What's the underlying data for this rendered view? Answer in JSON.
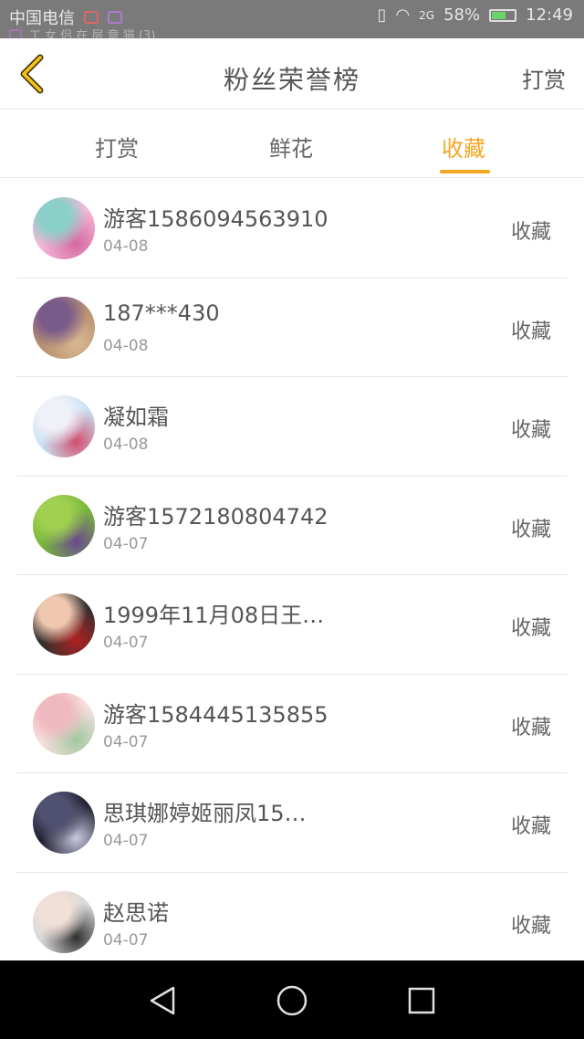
{
  "status_bar": {
    "carrier": "中国电信",
    "signal": "2G",
    "battery": "58%",
    "time": "12:49",
    "notification": "工 女 侣 在 层 章 猫 (3)"
  },
  "header": {
    "title": "粉丝荣誉榜",
    "action": "打赏",
    "back_icon": "chevron-left-icon"
  },
  "tabs": [
    {
      "label": "打赏",
      "active": false
    },
    {
      "label": "鲜花",
      "active": false
    },
    {
      "label": "收藏",
      "active": true
    }
  ],
  "colors": {
    "accent": "#f5a623",
    "text": "#555555",
    "muted": "#999999",
    "divider": "#e6e6e6"
  },
  "fans": [
    {
      "name": "游客1586094563910",
      "date": "04-08",
      "type": "收藏",
      "avatar_colors": [
        "#f6b6d8",
        "#8ad0c8",
        "#d46aa0"
      ]
    },
    {
      "name": "187***430",
      "date": "04-08",
      "type": "收藏",
      "avatar_colors": [
        "#b89070",
        "#7a5a8a",
        "#d8b890"
      ]
    },
    {
      "name": "凝如霜",
      "date": "04-08",
      "type": "收藏",
      "avatar_colors": [
        "#c8e4f4",
        "#f0f0f8",
        "#d05070"
      ]
    },
    {
      "name": "游客1572180804742",
      "date": "04-07",
      "type": "收藏",
      "avatar_colors": [
        "#7ab83a",
        "#a0d050",
        "#6a4a90"
      ]
    },
    {
      "name": "1999年11月08日王…",
      "date": "04-07",
      "type": "收藏",
      "avatar_colors": [
        "#303030",
        "#f0c8b0",
        "#b02020"
      ]
    },
    {
      "name": "游客1584445135855",
      "date": "04-07",
      "type": "收藏",
      "avatar_colors": [
        "#f8e0e0",
        "#f0b8c0",
        "#a0c8a0"
      ]
    },
    {
      "name": "思琪娜婷姬丽凤15…",
      "date": "04-07",
      "type": "收藏",
      "avatar_colors": [
        "#202030",
        "#505070",
        "#c8c8e0"
      ]
    },
    {
      "name": "赵思诺",
      "date": "04-07",
      "type": "收藏",
      "avatar_colors": [
        "#d8d8d8",
        "#f0e0d8",
        "#303030"
      ]
    }
  ],
  "nav": [
    "back-triangle-icon",
    "home-circle-icon",
    "recents-square-icon"
  ]
}
